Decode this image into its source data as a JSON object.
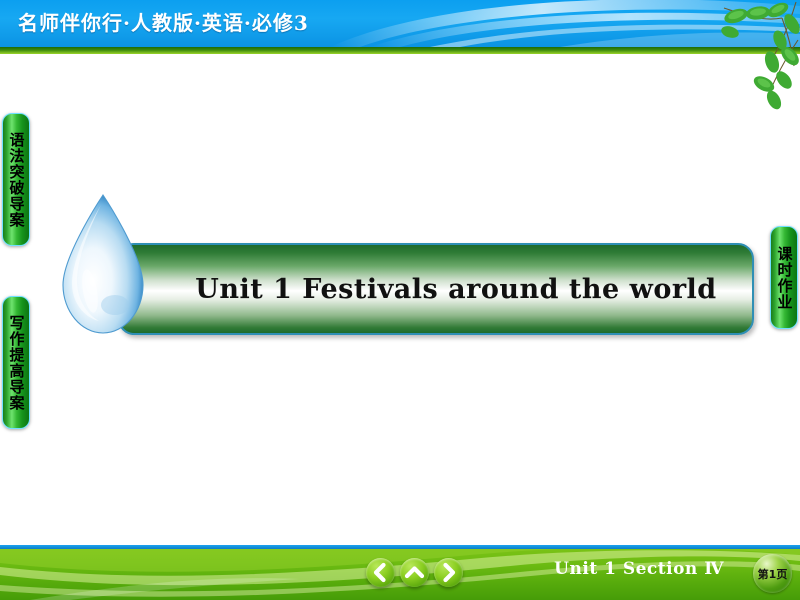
{
  "header": {
    "title": "名师伴你行·人教版·英语·必修3",
    "bg_color": "#0d9ef0",
    "stripe_color": "#3f8c0d",
    "leaves_icon": "leaves-branch-icon"
  },
  "side_tabs": {
    "left": [
      {
        "label": "语法突破导案",
        "name": "tab-grammar"
      },
      {
        "label": "写作提高导案",
        "name": "tab-writing"
      }
    ],
    "right": [
      {
        "label": "课时作业",
        "name": "tab-homework"
      }
    ],
    "color": "#2ca32c"
  },
  "main": {
    "banner_title": "Unit 1    Festivals around the world",
    "droplet_icon": "water-droplet-icon"
  },
  "footer": {
    "nav": [
      {
        "label": "",
        "icon": "chevron-left-icon",
        "name": "nav-prev"
      },
      {
        "label": "",
        "icon": "chevron-up-icon",
        "name": "nav-up"
      },
      {
        "label": "",
        "icon": "chevron-right-icon",
        "name": "nav-next"
      }
    ],
    "caption": "Unit 1    Section Ⅳ",
    "page_badge": "第1页",
    "bg_color": "#6cbb12",
    "topline_color": "#1aa3f0"
  }
}
